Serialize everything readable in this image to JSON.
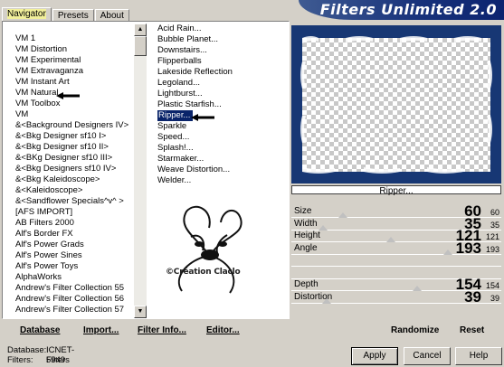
{
  "tabs": [
    {
      "label": "Navigator",
      "active": true
    },
    {
      "label": "Presets",
      "active": false
    },
    {
      "label": "About",
      "active": false
    }
  ],
  "title": "Filters Unlimited 2.0",
  "categories": [
    "VM 1",
    "VM Distortion",
    "VM Experimental",
    "VM Extravaganza",
    "VM Instant Art",
    "VM Natural",
    "VM Toolbox",
    "VM",
    "&<Background Designers IV>",
    "&<Bkg Designer sf10 I>",
    "&<Bkg Designer sf10 II>",
    "&<BKg Designer sf10 III>",
    "&<Bkg Designers sf10 IV>",
    "&<Bkg Kaleidoscope>",
    "&<Kaleidoscope>",
    "&<Sandflower Specials^v^ >",
    "[AFS IMPORT]",
    "AB Filters 2000",
    "Alf's Border FX",
    "Alf's Power Grads",
    "Alf's Power Sines",
    "Alf's Power Toys",
    "AlphaWorks",
    "Andrew's Filter Collection 55",
    "Andrew's Filter Collection 56",
    "Andrew's Filter Collection 57"
  ],
  "filters": [
    "Acid Rain...",
    "Bubble Planet...",
    "Downstairs...",
    "Flipperballs",
    "Lakeside Reflection",
    "Legoland...",
    "Lightburst...",
    "Plastic Starfish...",
    "Ripper...",
    "Sparkle",
    "Speed...",
    "Splash!...",
    "Starmaker...",
    "Weave Distortion...",
    "Welder..."
  ],
  "selected_filter_index": 8,
  "watermark_text": "©Création Claclo",
  "bottom_buttons": {
    "database": "Database",
    "import": "Import...",
    "filter_info": "Filter Info...",
    "editor": "Editor...",
    "randomize": "Randomize",
    "reset": "Reset"
  },
  "preview_label": "Ripper...",
  "sliders": [
    {
      "label": "Size",
      "value": "60",
      "small": "60",
      "level": 0.235
    },
    {
      "label": "Width",
      "value": "35",
      "small": "35",
      "level": 0.137
    },
    {
      "label": "Height",
      "value": "121",
      "small": "121",
      "level": 0.475
    },
    {
      "label": "Angle",
      "value": "193",
      "small": "193",
      "level": 0.757
    },
    {
      "label": "",
      "value": "",
      "small": "",
      "level": null
    },
    {
      "label": "",
      "value": "",
      "small": "",
      "level": null
    },
    {
      "label": "Depth",
      "value": "154",
      "small": "154",
      "level": 0.604
    },
    {
      "label": "Distortion",
      "value": "39",
      "small": "39",
      "level": 0.153
    }
  ],
  "footer": {
    "database_label": "Database:",
    "database_value": "ICNET-Filters",
    "filters_label": "Filters:",
    "filters_value": "5949"
  },
  "dialog_buttons": {
    "apply": "Apply",
    "cancel": "Cancel",
    "help": "Help"
  },
  "colors": {
    "selection": "#0a246a",
    "preview_frame": "#173774"
  }
}
